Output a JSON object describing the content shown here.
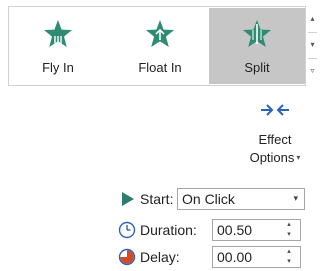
{
  "animation_gallery": {
    "items": [
      {
        "label": "Fly In",
        "icon": "fly-in-star-icon",
        "selected": false
      },
      {
        "label": "Float In",
        "icon": "float-in-star-icon",
        "selected": false
      },
      {
        "label": "Split",
        "icon": "split-star-icon",
        "selected": true
      }
    ],
    "scroll_up_glyph": "▴",
    "scroll_down_glyph": "▾",
    "more_glyph": "▿",
    "star_color": "#2e8b74",
    "selected_background": "#c6c6c6"
  },
  "effect_options": {
    "line1": "Effect",
    "line2": "Options",
    "caret": "▾",
    "icon": "arrows-inward-icon",
    "icon_color": "#2b63b8"
  },
  "timing": {
    "start": {
      "label": "Start:",
      "value": "On Click",
      "icon": "play-triangle-icon",
      "dropdown_glyph": "▾"
    },
    "duration": {
      "label": "Duration:",
      "value": "00.50",
      "icon": "clock-icon"
    },
    "delay": {
      "label": "Delay:",
      "value": "00.00",
      "icon": "delay-pie-icon"
    },
    "spin_up_glyph": "▴",
    "spin_down_glyph": "▾",
    "icon_color": "#2e7d6e",
    "accent_color": "#d14a2a"
  }
}
